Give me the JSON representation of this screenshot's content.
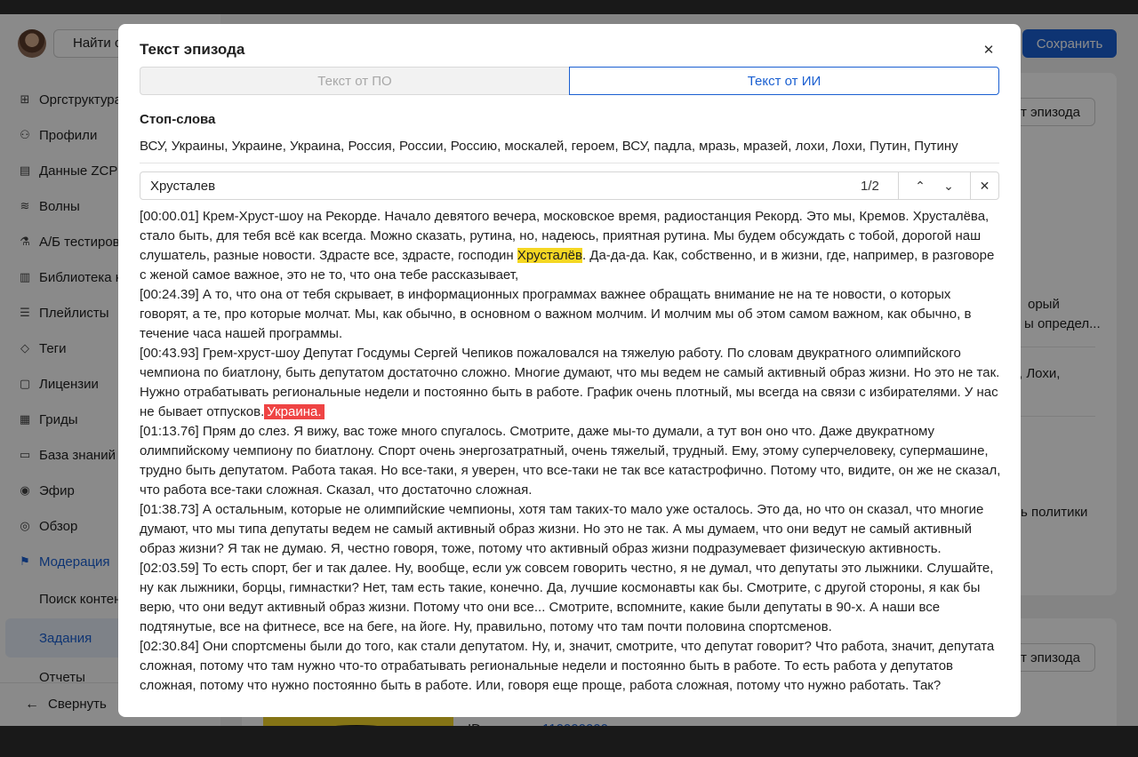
{
  "app": {
    "login_button": "Найти с",
    "save_button": "Сохранить",
    "nav": [
      {
        "label": "Оргструктура",
        "icon": "org-icon"
      },
      {
        "label": "Профили",
        "icon": "profiles-icon"
      },
      {
        "label": "Данные ZCP",
        "icon": "data-icon"
      },
      {
        "label": "Волны",
        "icon": "waves-icon"
      },
      {
        "label": "А/Б тестирование",
        "icon": "ab-test-icon"
      },
      {
        "label": "Библиотека конт",
        "icon": "library-icon"
      },
      {
        "label": "Плейлисты",
        "icon": "playlists-icon"
      },
      {
        "label": "Теги",
        "icon": "tag-icon"
      },
      {
        "label": "Лицензии",
        "icon": "license-icon"
      },
      {
        "label": "Гриды",
        "icon": "grid-icon"
      },
      {
        "label": "База знаний",
        "icon": "knowledge-icon"
      },
      {
        "label": "Эфир",
        "icon": "broadcast-icon"
      },
      {
        "label": "Обзор",
        "icon": "compass-icon"
      },
      {
        "label": "Модерация",
        "icon": "moderation-icon"
      }
    ],
    "sub_nav": [
      "Поиск контента",
      "Задания",
      "Отчеты"
    ],
    "collapse_label": "Свернуть",
    "episode_text_button": "Текст эпизода",
    "episode_text_button_2": "Текст эпизода",
    "bg_snippets": [
      "орый",
      "ы определ...",
      ", Лохи,",
      "ь политики",
      "ID",
      "110000000"
    ]
  },
  "modal": {
    "title": "Текст эпизода",
    "tabs": [
      "Текст от ПО",
      "Текст от ИИ"
    ],
    "stop_words_label": "Стоп-слова",
    "stop_words": "ВСУ, Украины, Украине, Украина, Россия, России, Россию, москалей, героем, ВСУ, падла, мразь, мразей, лохи, Лохи, Путин, Путину",
    "search_value": "Хрусталев",
    "search_count": "1/2",
    "transcript": [
      {
        "ts": "[00:00.01]",
        "before": " Крем-Хруст-шоу на Рекорде. Начало девятого вечера, московское время, радиостанция Рекорд. Это мы, Кремов. Хрусталёва, стало быть, для тебя всё как всегда. Можно сказать, рутина, но, надеюсь, приятная рутина. Мы будем обсуждать с тобой, дорогой наш слушатель, разные новости. Здрасте все, здрасте, господин ",
        "highlight": "Хрусталёв",
        "after": ". Да-да-да. Как, собственно, и в жизни, где, например, в разговоре с женой самое важное, это не то, что она тебе рассказывает,"
      },
      {
        "ts": "[00:24.39]",
        "before": " А то, что она от тебя скрывает, в информационных программах важнее обращать внимание не на те новости, о которых говорят, а те, про которые молчат. Мы, как обычно, в основном о важном молчим. И молчим мы об этом самом важном, как обычно, в течение часа нашей программы.",
        "highlight": "",
        "after": ""
      },
      {
        "ts": "[00:43.93]",
        "before": " Грем-хруст-шоу Депутат Госдумы Сергей Чепиков пожаловался на тяжелую работу. По словам двукратного олимпийского чемпиона по биатлону, быть депутатом достаточно сложно. Многие думают, что мы ведем не самый активный образ жизни. Но это не так. Нужно отрабатывать региональные недели и постоянно быть в работе. График очень плотный, мы всегда на связи с избирателями. У нас не бывает отпусков.",
        "stopword": "Украина.",
        "highlight": "",
        "after": ""
      },
      {
        "ts": "[01:13.76]",
        "before": " Прям до слез. Я вижу, вас тоже много спугалось. Смотрите, даже мы-то думали, а тут вон оно что. Даже двукратному олимпийскому чемпиону по биатлону. Спорт очень энергозатратный, очень тяжелый, трудный. Ему, этому суперчеловеку, супермашине, трудно быть депутатом. Работа такая. Но все-таки, я уверен, что все-таки не так все катастрофично. Потому что, видите, он же не сказал, что работа все-таки сложная. Сказал, что достаточно сложная.",
        "highlight": "",
        "after": ""
      },
      {
        "ts": "[01:38.73]",
        "before": " А остальным, которые не олимпийские чемпионы, хотя там таких-то мало уже осталось. Это да, но что он сказал, что многие думают, что мы типа депутаты ведем не самый активный образ жизни. Но это не так. А мы думаем, что они ведут не самый активный образ жизни? Я так не думаю. Я, честно говоря, тоже, потому что активный образ жизни подразумевает физическую активность.",
        "highlight": "",
        "after": ""
      },
      {
        "ts": "[02:03.59]",
        "before": " То есть спорт, бег и так далее. Ну, вообще, если уж совсем говорить честно, я не думал, что депутаты это лыжники. Слушайте, ну как лыжники, борцы, гимнастки? Нет, там есть такие, конечно. Да, лучшие космонавты как бы. Смотрите, с другой стороны, я как бы верю, что они ведут активный образ жизни. Потому что они все... Смотрите, вспомните, какие были депутаты в 90-х. А наши все подтянутые, все на фитнесе, все на беге, на йоге. Ну, правильно, потому что там почти половина спортсменов.",
        "highlight": "",
        "after": ""
      },
      {
        "ts": "[02:30.84]",
        "before": " Они спортсмены были до того, как стали депутатом. Ну, и, значит, смотрите, что депутат говорит? Что работа, значит, депутата сложная, потому что там нужно что-то отрабатывать региональные недели и постоянно быть в работе. То есть работа у депутатов сложная, потому что нужно постоянно быть в работе. Или, говоря еще проще, работа сложная, потому что нужно работать. Так?",
        "highlight": "",
        "after": ""
      }
    ]
  },
  "colors": {
    "accent": "#1a5fd1",
    "search_highlight": "#f5d723",
    "stopword_highlight": "#ef4444"
  }
}
